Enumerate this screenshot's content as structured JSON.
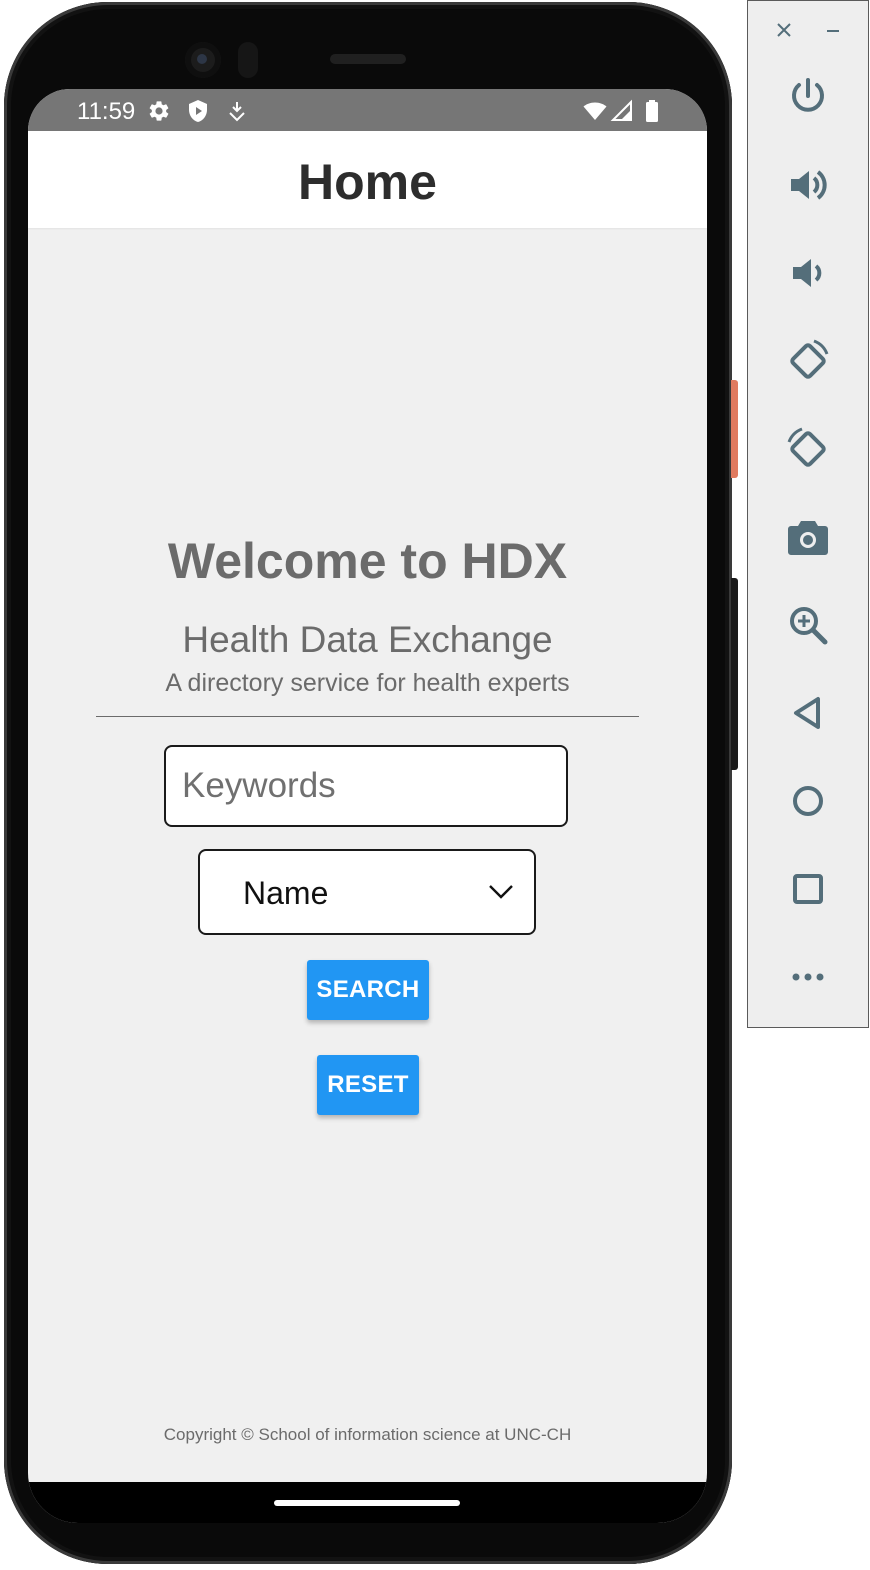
{
  "status_bar": {
    "time": "11:59",
    "left_icons": [
      "settings-icon",
      "shield-play-icon",
      "download-status-icon"
    ],
    "right_icons": [
      "wifi-icon",
      "signal-icon",
      "battery-icon"
    ]
  },
  "header": {
    "title": "Home"
  },
  "main": {
    "welcome_title": "Welcome to HDX",
    "subtitle": "Health Data Exchange",
    "tagline": "A directory service for health experts",
    "keywords": {
      "placeholder": "Keywords",
      "value": ""
    },
    "search_field": {
      "selected": "Name"
    },
    "search_button": "SEARCH",
    "reset_button": "RESET"
  },
  "footer": {
    "copyright": "Copyright © School of information science at UNC-CH"
  },
  "emulator_toolbar": {
    "window_controls": [
      "close-icon",
      "minimize-icon"
    ],
    "buttons": [
      "power-icon",
      "volume-up-icon",
      "volume-down-icon",
      "rotate-left-icon",
      "rotate-right-icon",
      "camera-icon",
      "zoom-icon",
      "back-icon",
      "home-icon",
      "overview-icon",
      "more-icon"
    ]
  },
  "colors": {
    "accent": "#2196f3",
    "status_bar": "#767676",
    "screen_background": "#f0f0f0",
    "text_muted": "#6b6b6b",
    "toolbar_icon": "#546e7a",
    "power_key": "#e07a5f"
  }
}
